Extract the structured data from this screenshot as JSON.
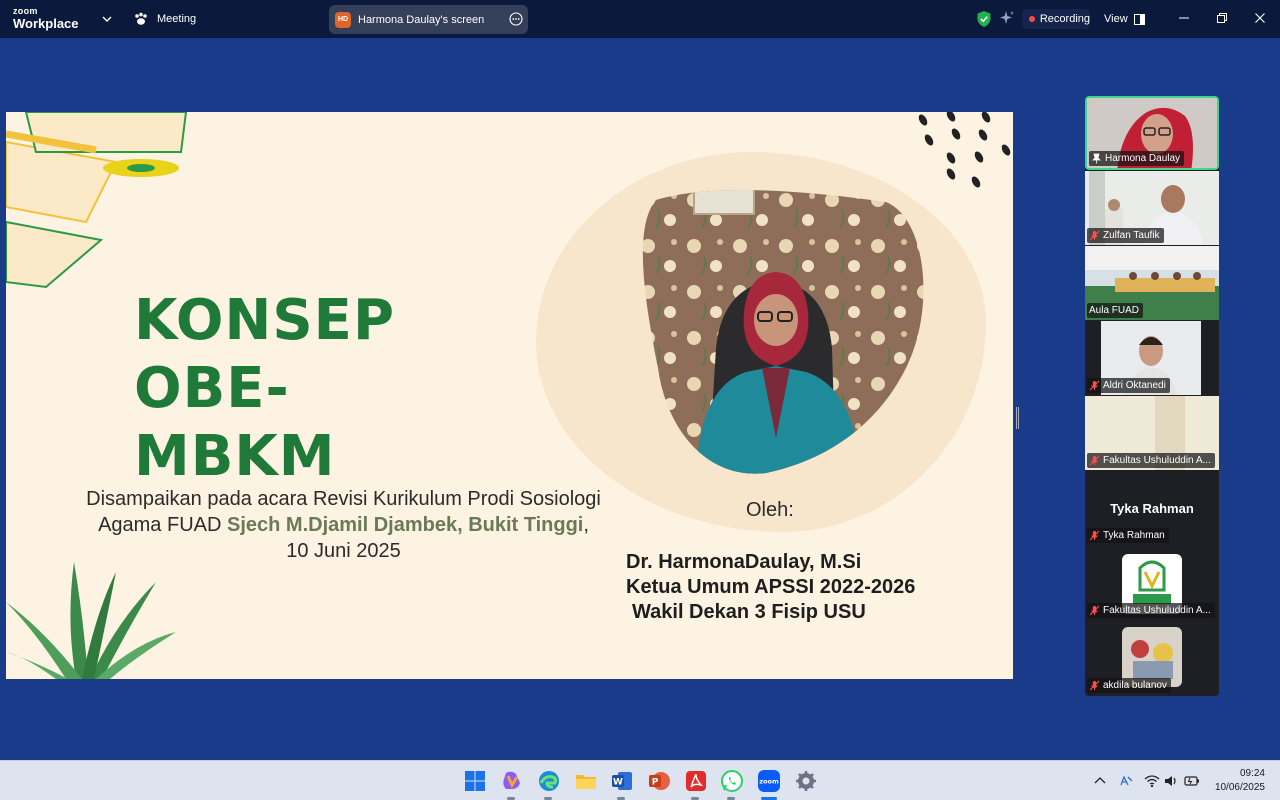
{
  "topbar": {
    "brand_small": "zoom",
    "brand_large": "Workplace",
    "meeting_label": "Meeting",
    "screen_initials": "HD",
    "screen_label": "Harmona Daulay's screen",
    "recording_label": "Recording",
    "view_label": "View"
  },
  "slide": {
    "title_line1": "KONSEP OBE-",
    "title_line2": "MBKM",
    "subtitle_line1": "Disampaikan pada acara Revisi Kurikulum Prodi Sosiologi",
    "subtitle_line2_prefix": "Agama FUAD ",
    "subtitle_line2_venue": "Sjech M.Djamil Djambek, Bukit Tinggi",
    "subtitle_line2_suffix": ",",
    "subtitle_line3": "10 Juni 2025",
    "oleh": "Oleh:",
    "author_name": "Dr. HarmonaDaulay, M.Si",
    "author_role1": "Ketua Umum APSSI 2022-2026",
    "author_role2": "Wakil Dekan 3 Fisip USU"
  },
  "participants": [
    {
      "name": "Harmona Daulay",
      "icon": "pin-icon",
      "active": true
    },
    {
      "name": "Zulfan Taufik",
      "icon": "mic-muted-icon"
    },
    {
      "name": "Aula FUAD",
      "icon": ""
    },
    {
      "name": "Aldri Oktanedi",
      "icon": "mic-muted-icon"
    },
    {
      "name": "Fakultas Ushuluddin A...",
      "icon": "mic-muted-icon"
    },
    {
      "name": "Tyka Rahman",
      "icon": "mic-muted-icon",
      "display": "Tyka Rahman"
    },
    {
      "name": "Fakultas Ushuluddin A...",
      "icon": "mic-muted-icon"
    },
    {
      "name": "akdila bulanov",
      "icon": "mic-muted-icon"
    }
  ],
  "taskbar": {
    "time": "09:24",
    "date": "10/06/2025",
    "apps": [
      "windows-start",
      "copilot",
      "edge",
      "file-explorer",
      "word",
      "powerpoint",
      "acrobat",
      "whatsapp",
      "zoom",
      "settings"
    ]
  },
  "colors": {
    "title_green": "#1f7a3a",
    "zoom_bg": "#1a3a8a",
    "active_border": "#3ed68d"
  }
}
